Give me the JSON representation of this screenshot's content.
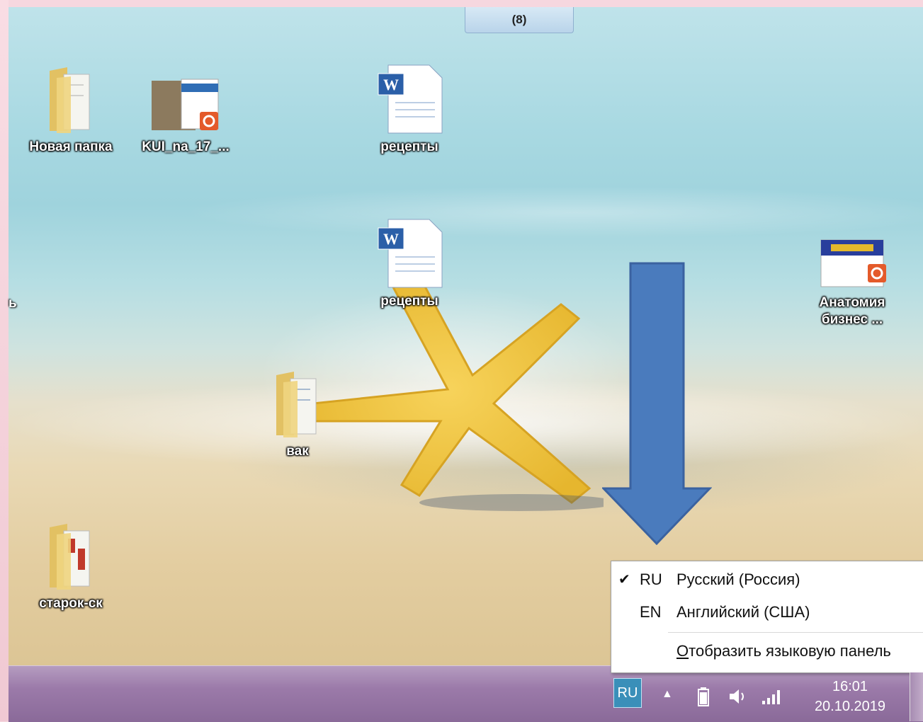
{
  "window": {
    "top_tab_label": "(8)"
  },
  "desktop": {
    "icons": [
      {
        "label": "Новая папка",
        "type": "folder"
      },
      {
        "label": "KUI_na_17_...",
        "type": "pdf-image"
      },
      {
        "label": "рецепты",
        "type": "word-doc"
      },
      {
        "label": "рецепты",
        "type": "word-doc"
      },
      {
        "label": "Анатомия бизнес ...",
        "type": "pdf-image"
      },
      {
        "label": "вак",
        "type": "folder"
      },
      {
        "label": "старок-ск",
        "type": "folder"
      }
    ],
    "partial_label": "ь"
  },
  "language_menu": {
    "items": [
      {
        "checked": true,
        "code": "RU",
        "name": "Русский (Россия)"
      },
      {
        "checked": false,
        "code": "EN",
        "name": "Английский (США)"
      }
    ],
    "show_bar_label_underlined": "О",
    "show_bar_label_rest": "тобразить языковую панель"
  },
  "taskbar": {
    "language_indicator": "RU",
    "clock": {
      "time": "16:01",
      "date": "20.10.2019"
    }
  },
  "colors": {
    "arrow": "#4a7bbd",
    "taskbar": "#9b7aa9",
    "frame": "#f6d7df"
  }
}
